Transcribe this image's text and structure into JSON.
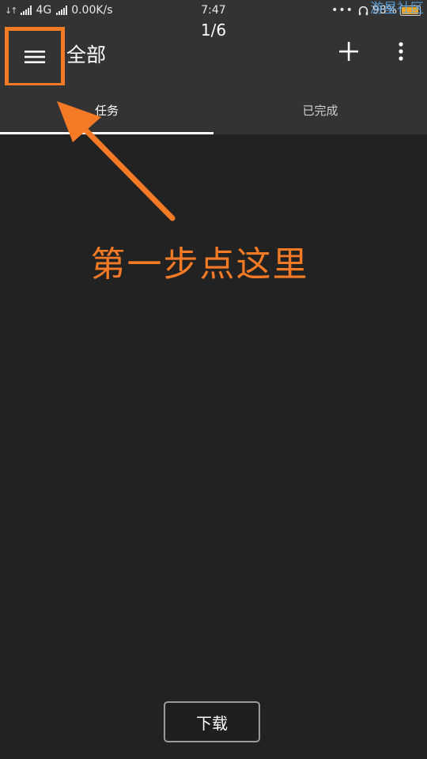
{
  "status_bar": {
    "network": "4G",
    "speed": "0.00K/s",
    "time": "7:47",
    "overflow_dots": "•••",
    "battery": "98%",
    "watermark": "游星社区"
  },
  "app_bar": {
    "page_counter": "1/6",
    "title": "全部",
    "menu_icon": "hamburger-menu-icon",
    "add_icon": "plus-icon",
    "overflow_icon": "vertical-dots-icon"
  },
  "tabs": [
    {
      "label": "任务",
      "selected": true
    },
    {
      "label": "已完成",
      "selected": false
    }
  ],
  "annotation": {
    "text": "第一步点这里",
    "color": "#f47a26"
  },
  "bottom": {
    "download_label": "下载"
  },
  "colors": {
    "background": "#222222",
    "bar": "#333333",
    "accent": "#f47a26",
    "battery": "#f5a623"
  }
}
